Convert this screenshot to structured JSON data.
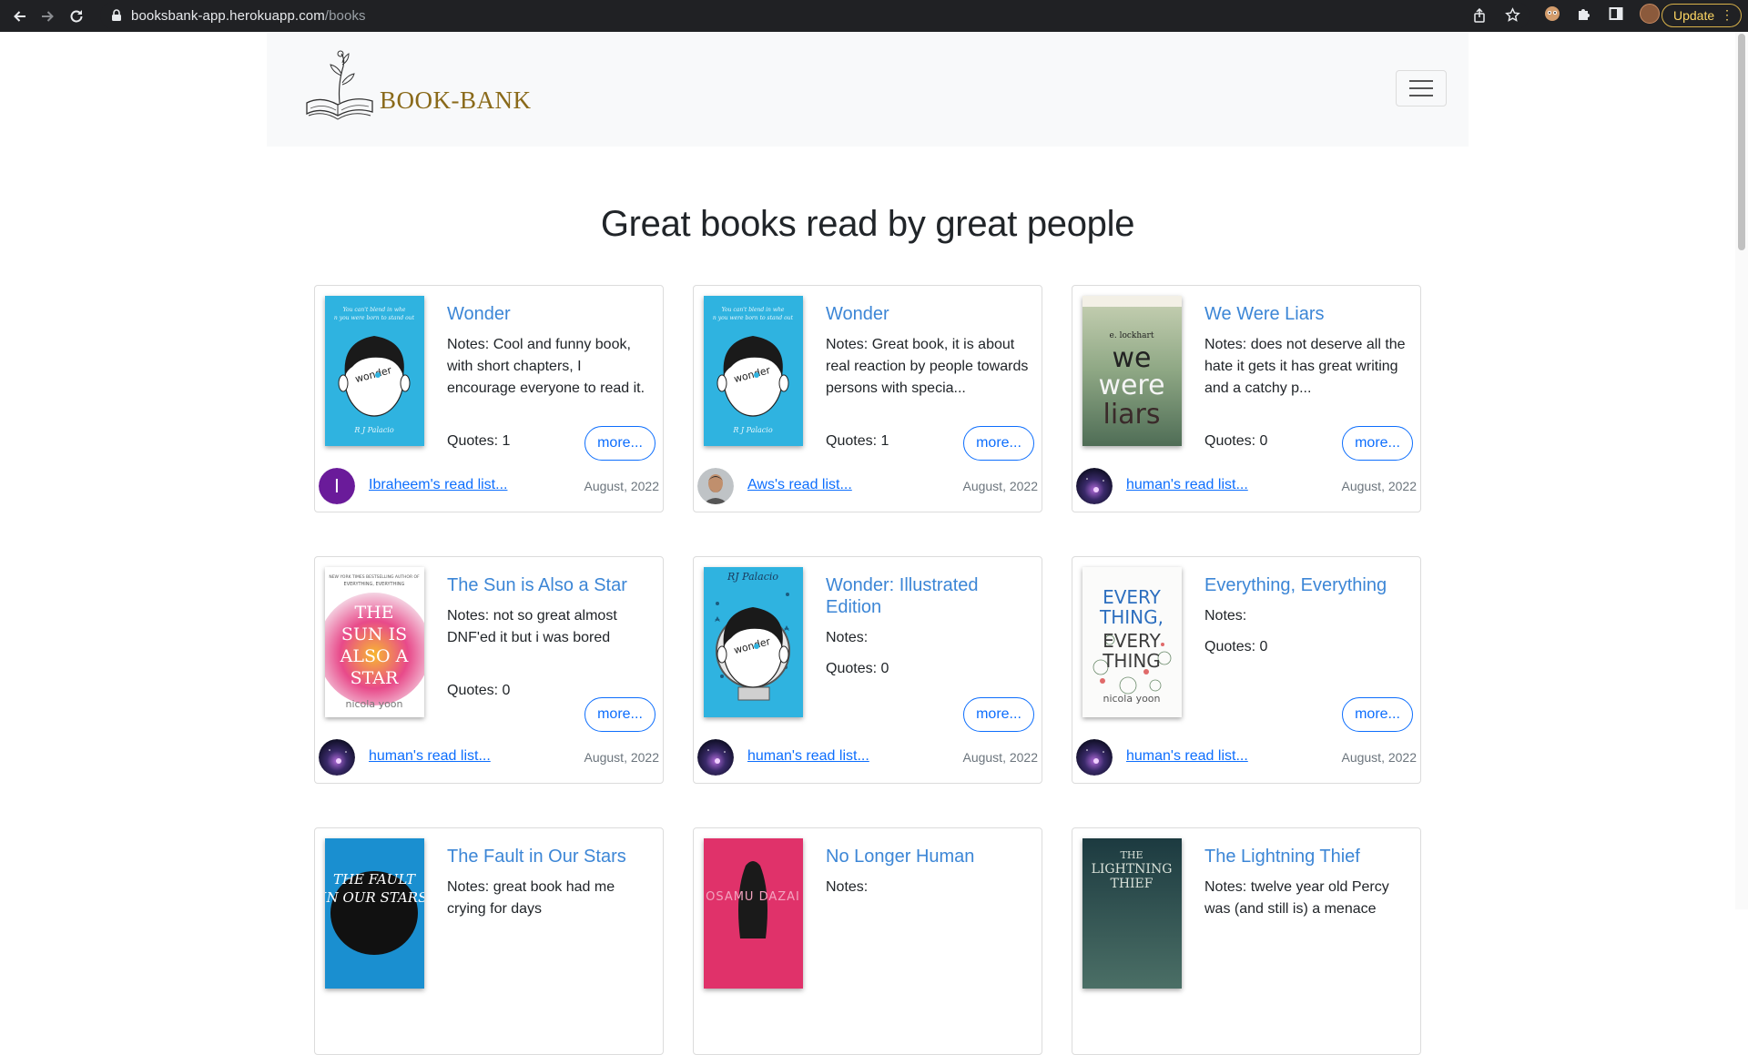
{
  "browser": {
    "url_host": "booksbank-app.herokuapp.com",
    "url_path": "/books",
    "update_label": "Update"
  },
  "navbar": {
    "brand": "BOOK-BANK"
  },
  "page": {
    "heading": "Great books read by great people"
  },
  "cards": [
    {
      "title": "Wonder",
      "notes": "Notes: Cool and funny book, with short chapters, I encourage everyone to read it.",
      "quotes": "Quotes: 1",
      "more": "more...",
      "user": "Ibraheem's read list...",
      "date": "August, 2022",
      "avatar": "letter",
      "avatar_letter": "I",
      "avatar_color": "#6a1b9a",
      "cover": "wonder"
    },
    {
      "title": "Wonder",
      "notes": "Notes: Great book, it is about real reaction by people towards persons with specia...",
      "quotes": "Quotes: 1",
      "more": "more...",
      "user": "Aws's read list...",
      "date": "August, 2022",
      "avatar": "photo",
      "cover": "wonder"
    },
    {
      "title": "We Were Liars",
      "notes": "Notes: does not deserve all the hate it gets it has great writing and a catchy p...",
      "quotes": "Quotes: 0",
      "more": "more...",
      "user": "human's read list...",
      "date": "August, 2022",
      "avatar": "galaxy",
      "cover": "liars"
    },
    {
      "title": "The Sun is Also a Star",
      "notes": "Notes: not so great almost DNF'ed it but i was bored",
      "quotes": "Quotes: 0",
      "more": "more...",
      "user": "human's read list...",
      "date": "August, 2022",
      "avatar": "galaxy",
      "cover": "sun"
    },
    {
      "title": "Wonder: Illustrated Edition",
      "notes": "Notes:",
      "quotes": "Quotes: 0",
      "more": "more...",
      "user": "human's read list...",
      "date": "August, 2022",
      "avatar": "galaxy",
      "cover": "wonder-ill"
    },
    {
      "title": "Everything, Everything",
      "notes": "Notes:",
      "quotes": "Quotes: 0",
      "more": "more...",
      "user": "human's read list...",
      "date": "August, 2022",
      "avatar": "galaxy",
      "cover": "everything"
    },
    {
      "title": "The Fault in Our Stars",
      "notes": "Notes: great book had me crying for days",
      "cover": "fault"
    },
    {
      "title": "No Longer Human",
      "notes": "Notes:",
      "cover": "human"
    },
    {
      "title": "The Lightning Thief",
      "notes": "Notes: twelve year old Percy was (and still is) a menace",
      "cover": "lightning"
    }
  ],
  "cover_text": {
    "wonder_top": "You can't blend in when you were born to stand out",
    "wonder_author": "R J Palacio",
    "wonder_ill_author": "RJ Palacio",
    "liars_author": "e. lockhart",
    "liars_title": "we were liars",
    "sun_title": "THE SUN IS ALSO A STAR",
    "sun_author": "nicola yoon",
    "every_title": "EVERY THING, EVERY THING",
    "every_author": "nicola yoon",
    "fault_title": "THE FAULT IN OUR STARS",
    "human_author": "OSAMU DAZAI",
    "lightning_title": "THE LIGHTNING THIEF"
  },
  "colors": {
    "link": "#0d6efd",
    "title": "#3c86d6",
    "brand": "#8a6a1a"
  }
}
